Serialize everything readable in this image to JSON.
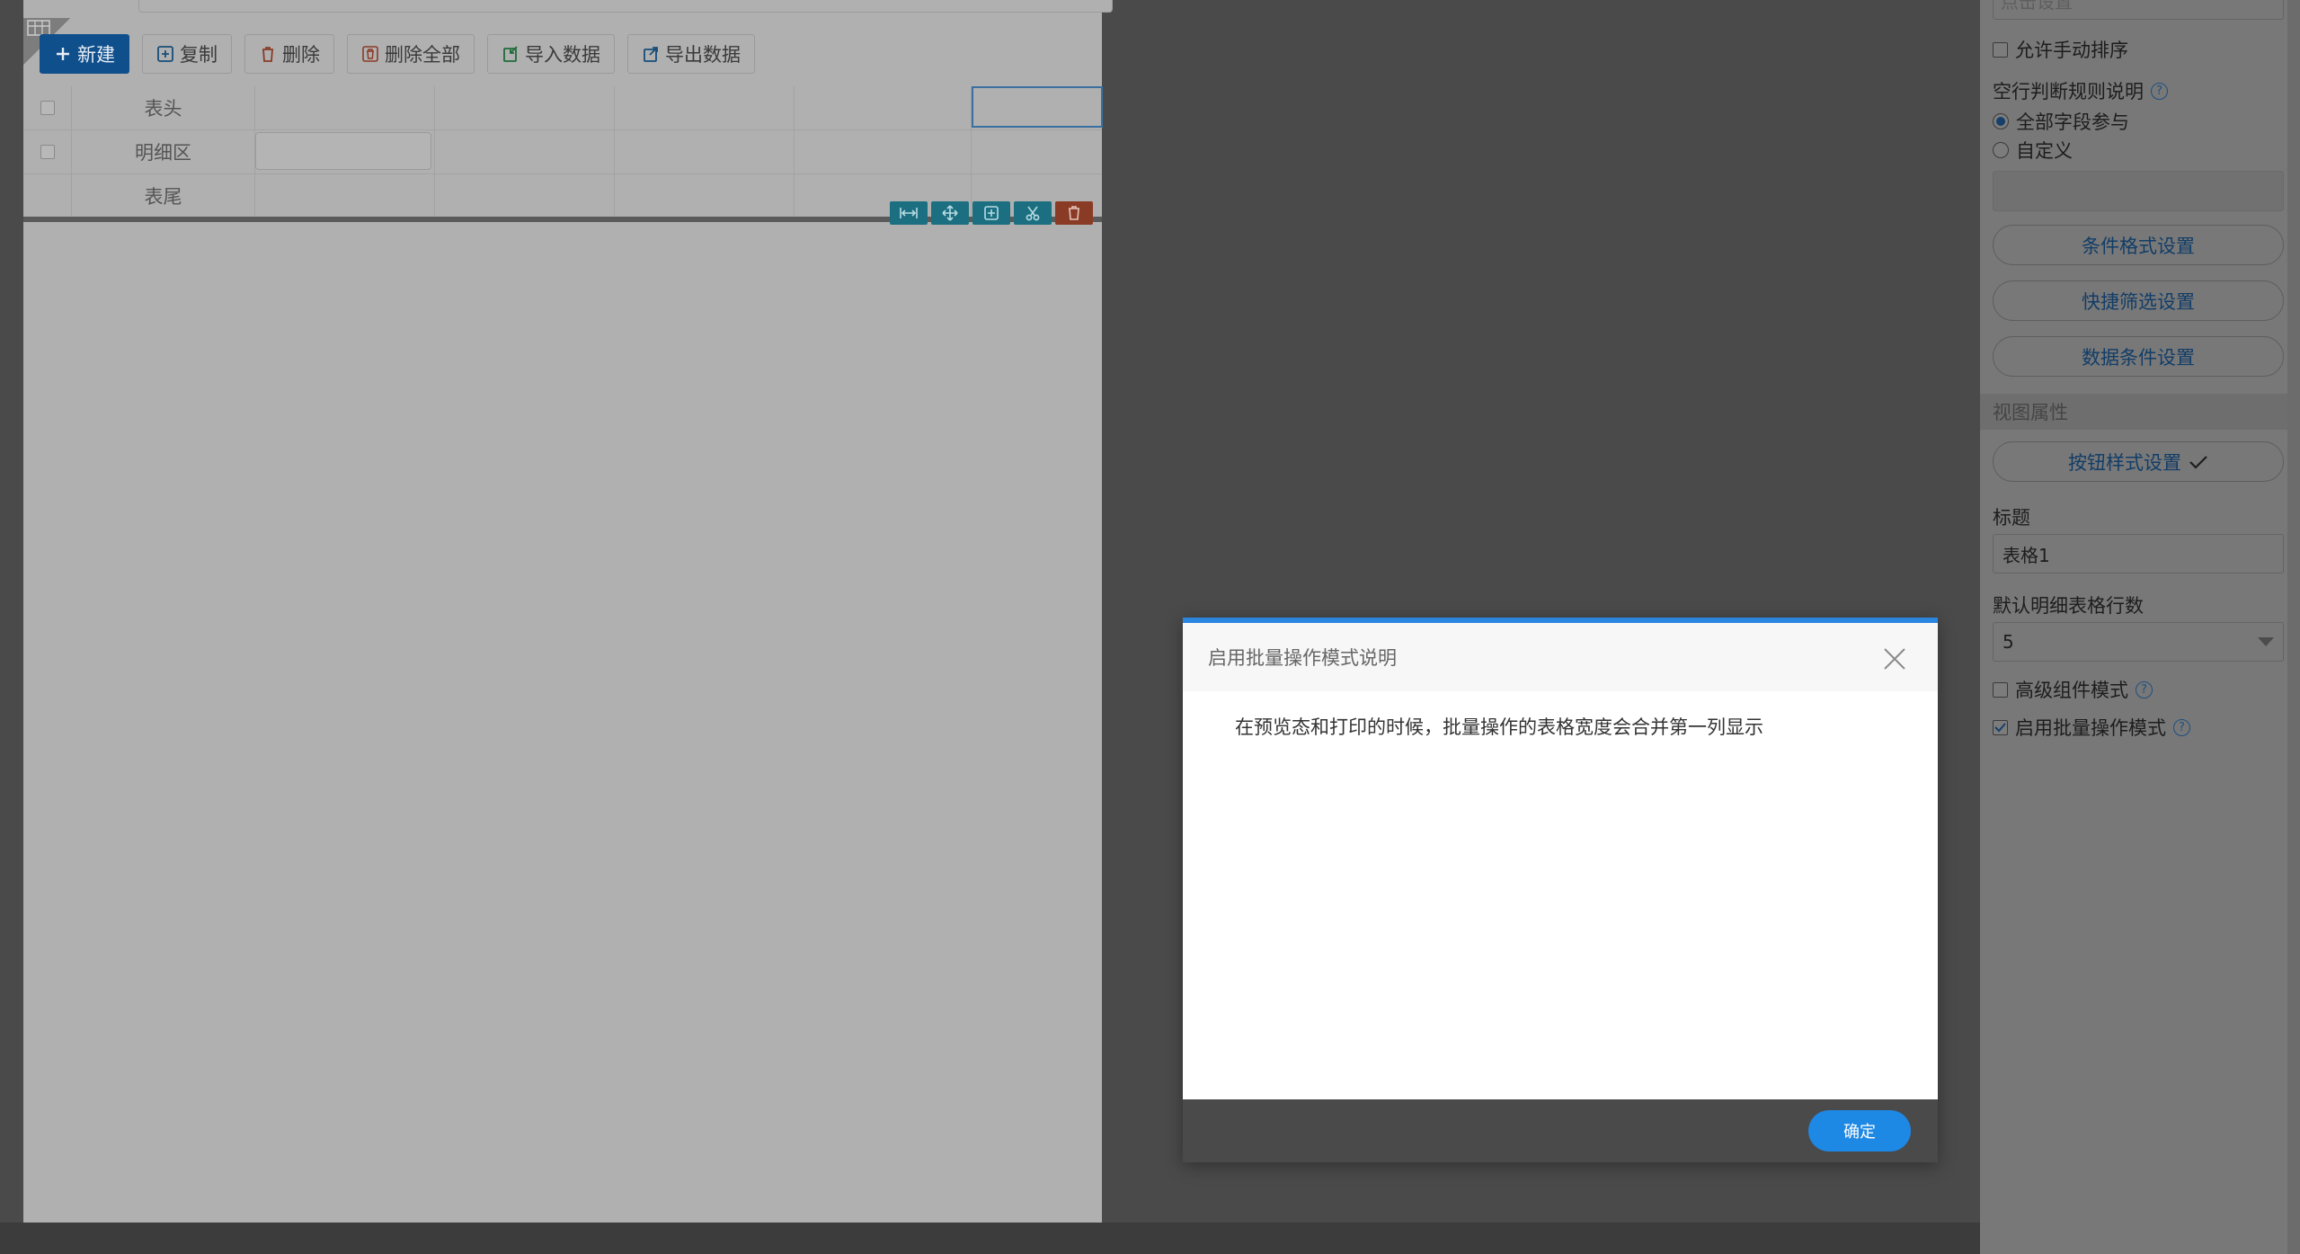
{
  "toolbar": {
    "new_label": "新建",
    "copy_label": "复制",
    "delete_label": "删除",
    "delete_all_label": "删除全部",
    "import_label": "导入数据",
    "export_label": "导出数据"
  },
  "grid": {
    "rows": [
      "表头",
      "明细区",
      "表尾"
    ]
  },
  "panel": {
    "top_stub": "点击设置",
    "allow_manual_sort": "允许手动排序",
    "empty_row_rule_label": "空行判断规则说明",
    "radio_all_fields": "全部字段参与",
    "radio_custom": "自定义",
    "btn_condition_format": "条件格式设置",
    "btn_quick_filter": "快捷筛选设置",
    "btn_data_condition": "数据条件设置",
    "section_view_props": "视图属性",
    "btn_button_style": "按钮样式设置",
    "title_label": "标题",
    "title_value": "表格1",
    "default_rows_label": "默认明细表格行数",
    "default_rows_value": "5",
    "advanced_mode": "高级组件模式",
    "batch_mode": "启用批量操作模式"
  },
  "modal": {
    "title": "启用批量操作模式说明",
    "body": "在预览态和打印的时候，批量操作的表格宽度会合并第一列显示",
    "ok_label": "确定"
  },
  "colors": {
    "accent": "#2b86e0",
    "ok_button": "#1e88e5"
  },
  "icons": [
    "plus-icon",
    "copy-icon",
    "trash-icon",
    "import-icon",
    "export-icon",
    "close-icon",
    "help-icon",
    "check-icon"
  ]
}
